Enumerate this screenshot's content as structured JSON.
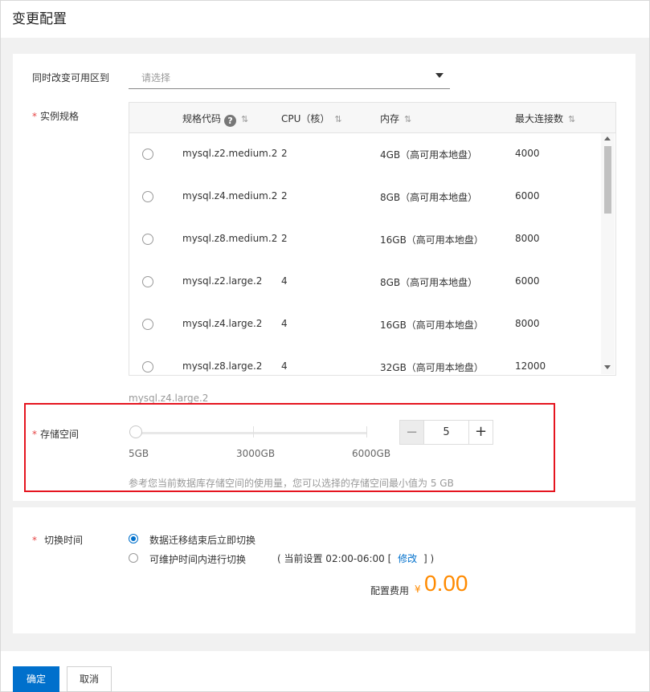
{
  "header": {
    "title": "变更配置"
  },
  "zone": {
    "label": "同时改变可用区到",
    "placeholder": "请选择"
  },
  "spec": {
    "label": "实例规格",
    "columns": {
      "code": "规格代码",
      "cpu": "CPU（核）",
      "mem": "内存",
      "conn": "最大连接数"
    },
    "rows": [
      {
        "code": "mysql.z2.medium.2",
        "cpu": "2",
        "mem": "4GB（高可用本地盘）",
        "conn": "4000"
      },
      {
        "code": "mysql.z4.medium.2",
        "cpu": "2",
        "mem": "8GB（高可用本地盘）",
        "conn": "6000"
      },
      {
        "code": "mysql.z8.medium.2",
        "cpu": "2",
        "mem": "16GB（高可用本地盘）",
        "conn": "8000"
      },
      {
        "code": "mysql.z2.large.2",
        "cpu": "4",
        "mem": "8GB（高可用本地盘）",
        "conn": "6000"
      },
      {
        "code": "mysql.z4.large.2",
        "cpu": "4",
        "mem": "16GB（高可用本地盘）",
        "conn": "8000"
      },
      {
        "code": "mysql.z8.large.2",
        "cpu": "4",
        "mem": "32GB（高可用本地盘）",
        "conn": "12000"
      }
    ],
    "current": "mysql.z4.large.2"
  },
  "storage": {
    "label": "存储空间",
    "marks": [
      "5GB",
      "3000GB",
      "6000GB"
    ],
    "value": "5",
    "minus": "−",
    "plus": "+",
    "hint": "参考您当前数据库存储空间的使用量，您可以选择的存储空间最小值为 5 GB"
  },
  "switch": {
    "label": "切换时间",
    "option1": "数据迁移结束后立即切换",
    "option2": "可维护时间内进行切换",
    "current_prefix": "( 当前设置 02:00-06:00 [",
    "modify": "修改",
    "current_suffix": "] )"
  },
  "fee": {
    "label": "配置费用",
    "currency": "¥",
    "amount": "0.00"
  },
  "footer": {
    "ok": "确定",
    "cancel": "取消"
  }
}
